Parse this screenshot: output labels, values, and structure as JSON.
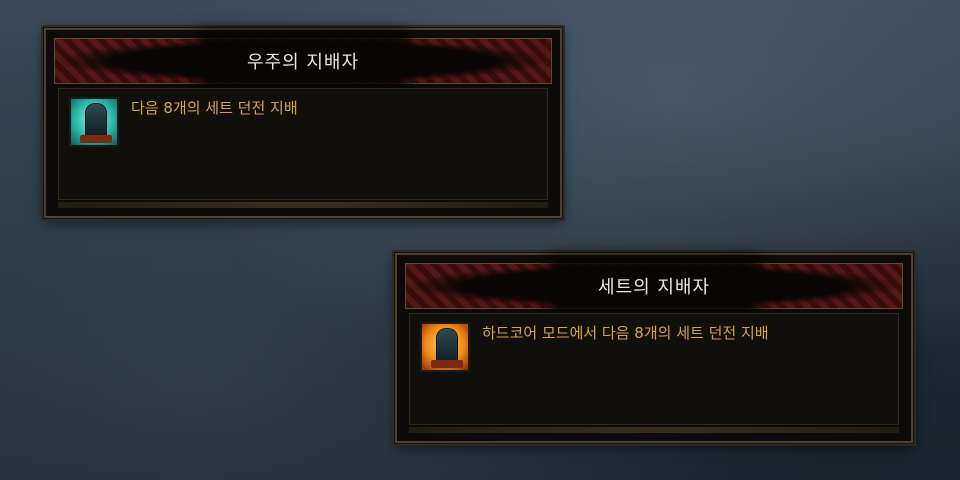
{
  "achievements": [
    {
      "title": "우주의 지배자",
      "description": "다음 8개의 세트 던전 지배",
      "icon": "dungeon-throne-icon",
      "icon_color": "#2bb8a8"
    },
    {
      "title": "세트의 지배자",
      "description": "하드코어 모드에서 다음 8개의 세트 던전 지배",
      "icon": "dungeon-throne-icon",
      "icon_color": "#f08a18"
    }
  ],
  "colors": {
    "title_text": "#e8e6e0",
    "description_text": "#d7a24a",
    "panel_bg": "#0d0b09"
  }
}
